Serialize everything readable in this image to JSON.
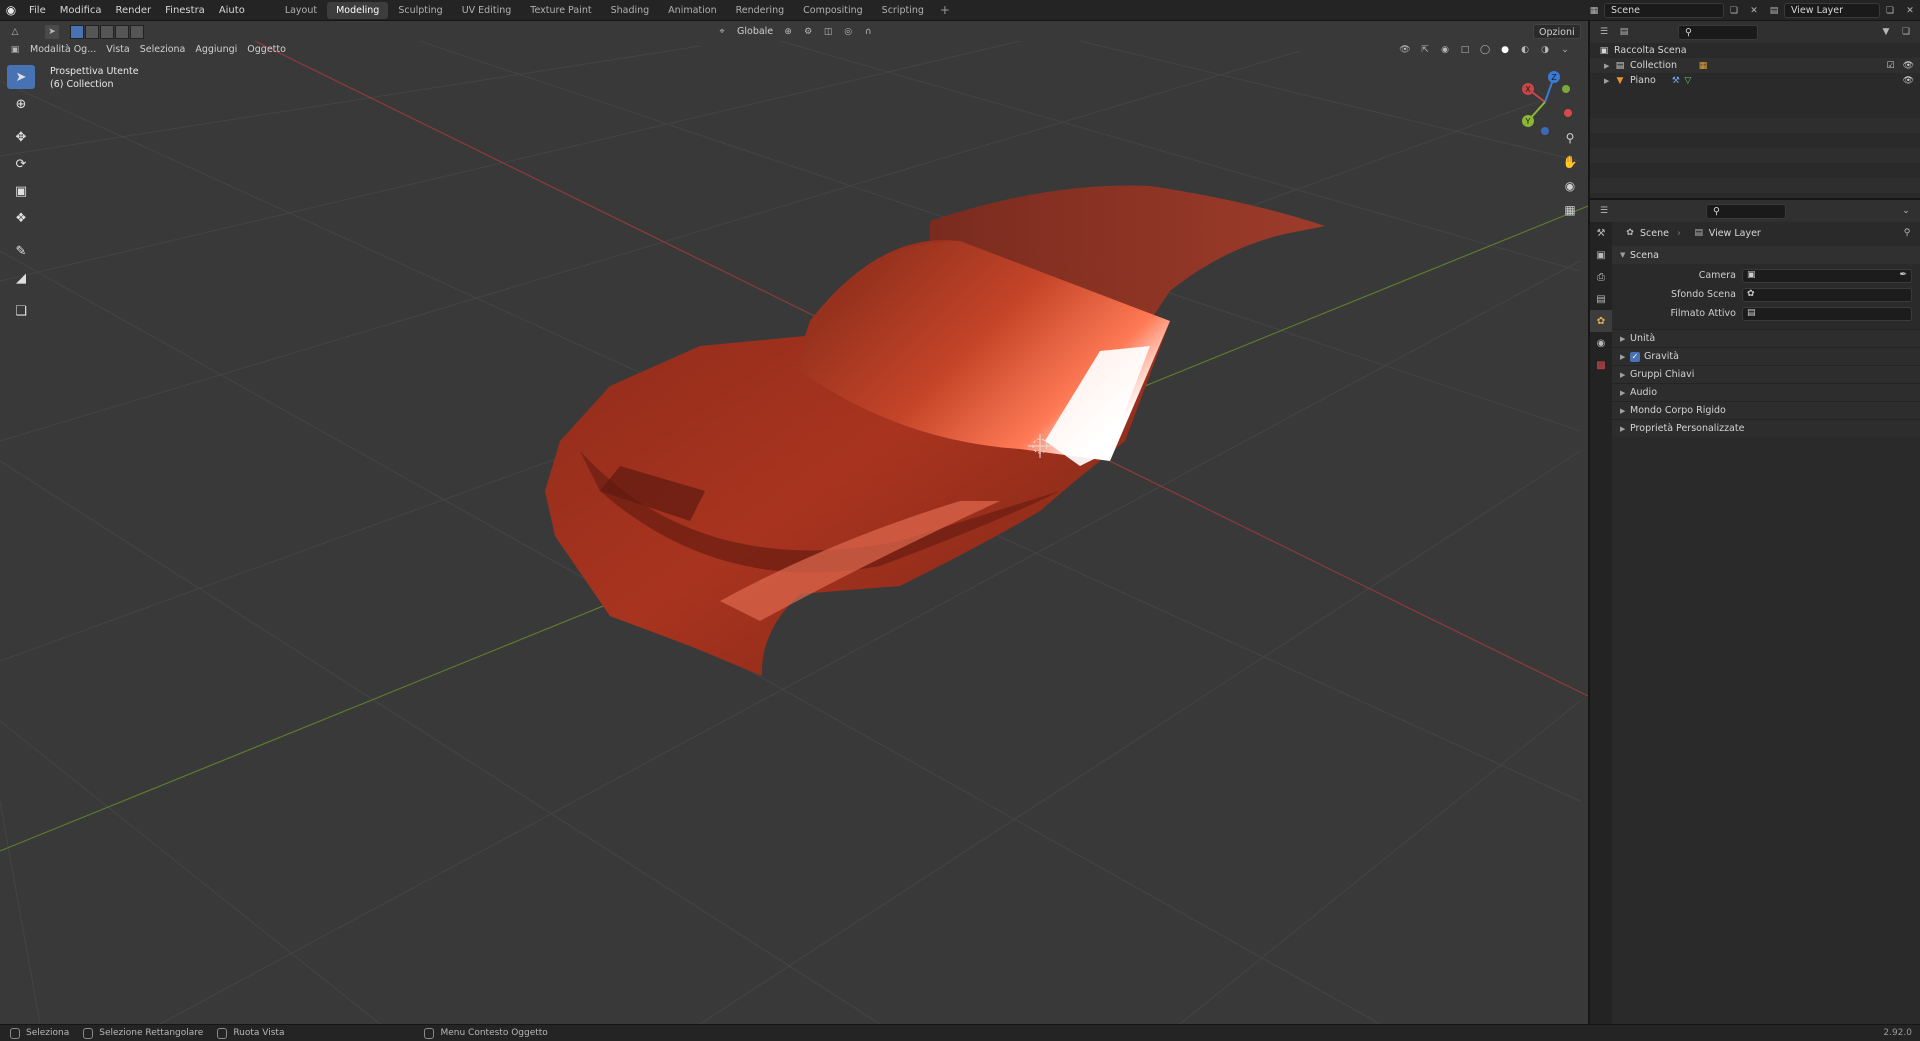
{
  "topbar": {
    "menu": [
      "File",
      "Modifica",
      "Render",
      "Finestra",
      "Aiuto"
    ],
    "workspaces": [
      "Layout",
      "Modeling",
      "Sculpting",
      "UV Editing",
      "Texture Paint",
      "Shading",
      "Animation",
      "Rendering",
      "Compositing",
      "Scripting"
    ],
    "active_workspace": "Modeling",
    "add_tab": "+",
    "scene": "Scene",
    "view_layer": "View Layer"
  },
  "viewport": {
    "mode": "Modalità Og...",
    "menus": [
      "Vista",
      "Seleziona",
      "Aggiungi",
      "Oggetto"
    ],
    "transform_orientation": "Globale",
    "options": "Opzioni",
    "info_line1": "Prospettiva Utente",
    "info_line2": "(6) Collection",
    "gizmo": {
      "x": "X",
      "y": "Y",
      "z": "Z"
    },
    "colors": {
      "x_axis": "#9b3a3a",
      "y_axis": "#6f8f2e",
      "object": "#b13a22"
    }
  },
  "outliner": {
    "root": "Raccolta Scena",
    "items": [
      {
        "label": "Collection"
      },
      {
        "label": "Piano"
      }
    ]
  },
  "properties": {
    "breadcrumb_scene": "Scene",
    "breadcrumb_layer": "View Layer",
    "panel_title": "Scena",
    "fields": [
      {
        "label": "Camera"
      },
      {
        "label": "Sfondo Scena"
      },
      {
        "label": "Filmato Attivo"
      }
    ],
    "subpanels": [
      "Unità",
      "Gravità",
      "Gruppi Chiavi",
      "Audio",
      "Mondo Corpo Rigido",
      "Proprietà Personalizzate"
    ],
    "gravity_checked": true
  },
  "statusbar": {
    "items": [
      "Seleziona",
      "Selezione Rettangolare",
      "Ruota Vista",
      "Menu Contesto Oggetto"
    ],
    "version": "2.92.0"
  }
}
